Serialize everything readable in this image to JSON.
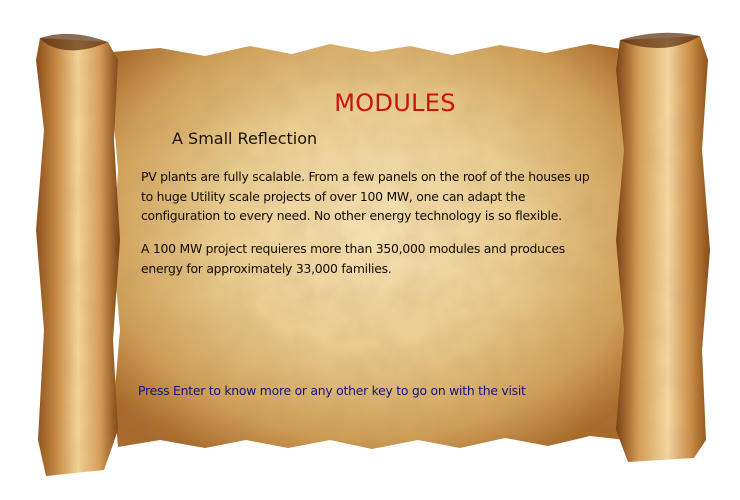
{
  "dialog": {
    "title": "MODULES",
    "subtitle": "A Small Reflection",
    "paragraphs": [
      "PV plants are fully scalable. From a few panels on the roof of the houses up to huge Utility scale projects of over 100 MW, one can adapt the configuration to every need. No other energy technology is so flexible.",
      "A 100 MW project requieres more than 350,000 modules and produces energy for approximately 33,000 families."
    ],
    "prompt": "Press Enter to know more or any other key to go on with the visit"
  },
  "colors": {
    "title": "#cc1111",
    "prompt": "#14147a",
    "parchment": "#e8c98c",
    "parchment_edge": "#a8682a"
  }
}
